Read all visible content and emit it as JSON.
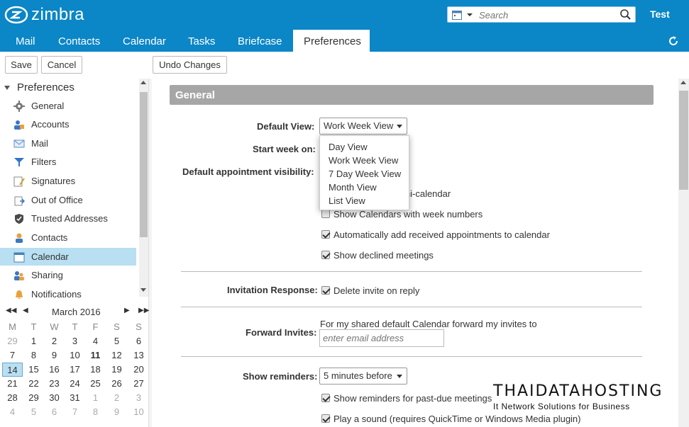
{
  "app": {
    "logo_text": "zimbra",
    "user": "Test"
  },
  "search": {
    "placeholder": "Search"
  },
  "tabs": [
    "Mail",
    "Contacts",
    "Calendar",
    "Tasks",
    "Briefcase",
    "Preferences"
  ],
  "toolbar": {
    "save": "Save",
    "cancel": "Cancel",
    "undo": "Undo Changes"
  },
  "tree": {
    "header": "Preferences",
    "items": [
      "General",
      "Accounts",
      "Mail",
      "Filters",
      "Signatures",
      "Out of Office",
      "Trusted Addresses",
      "Contacts",
      "Calendar",
      "Sharing",
      "Notifications"
    ],
    "selected": "Calendar"
  },
  "minical": {
    "month": "March 2016",
    "dow": [
      "M",
      "T",
      "W",
      "T",
      "F",
      "S",
      "S"
    ],
    "weeks": [
      [
        "29",
        "1",
        "2",
        "3",
        "4",
        "5",
        "6"
      ],
      [
        "7",
        "8",
        "9",
        "10",
        "11",
        "12",
        "13"
      ],
      [
        "14",
        "15",
        "16",
        "17",
        "18",
        "19",
        "20"
      ],
      [
        "21",
        "22",
        "23",
        "24",
        "25",
        "26",
        "27"
      ],
      [
        "28",
        "29",
        "30",
        "31",
        "1",
        "2",
        "3"
      ],
      [
        "4",
        "5",
        "6",
        "7",
        "8",
        "9",
        "10"
      ]
    ],
    "today": "11",
    "selected": "14"
  },
  "section": {
    "title": "General"
  },
  "form": {
    "default_view_label": "Default View:",
    "default_view_value": "Work Week View",
    "start_week_label": "Start week on:",
    "visibility_label": "Default appointment visibility:",
    "partial_minical": "ini-calendar",
    "partial_week_numbers": "Show Calendars with week numbers",
    "auto_add": "Automatically add received appointments to calendar",
    "show_declined": "Show declined meetings",
    "invitation_label": "Invitation Response:",
    "delete_invite": "Delete invite on reply",
    "forward_label": "Forward Invites:",
    "forward_text": "For my shared default Calendar forward my invites to",
    "email_placeholder": "enter email address",
    "reminders_label": "Show reminders:",
    "reminders_value": "5 minutes before",
    "past_due": "Show reminders for past-due meetings",
    "play_sound": "Play a sound (requires QuickTime or Windows Media plugin)"
  },
  "dropdown": {
    "items": [
      "Day View",
      "Work Week View",
      "7 Day Week View",
      "Month View",
      "List View"
    ]
  },
  "watermark": {
    "title": "THAIDATAHOSTING",
    "subtitle": "It Network Solutions for Business"
  },
  "colors": {
    "brand": "#0b86c6",
    "selected": "#b8dff2",
    "section": "#a6a6a6"
  }
}
